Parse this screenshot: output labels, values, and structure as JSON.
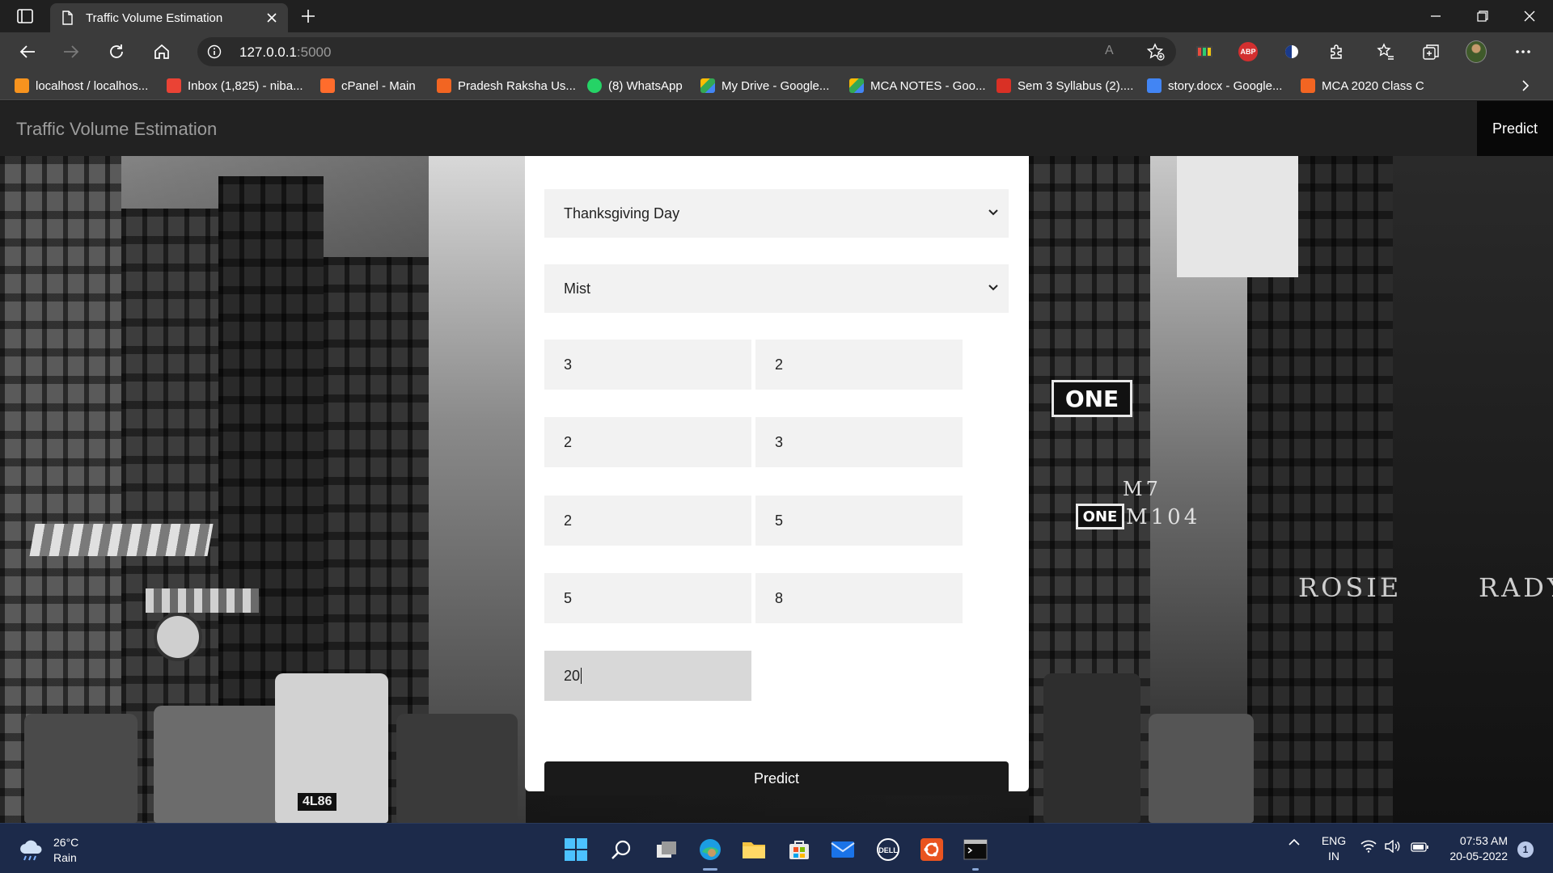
{
  "browser": {
    "tab_title": "Traffic Volume Estimation",
    "url_host": "127.0.0.1",
    "url_port": ":5000",
    "read_aloud_label": "A",
    "bookmarks": [
      {
        "label": "localhost / localhos...",
        "icon_color": "#f7931e"
      },
      {
        "label": "Inbox (1,825) - niba...",
        "icon_color": "#ea4335"
      },
      {
        "label": "cPanel - Main",
        "icon_color": "#ff6c2c"
      },
      {
        "label": "Pradesh Raksha Us...",
        "icon_color": "#f26522"
      },
      {
        "label": "(8) WhatsApp",
        "icon_color": "#25d366"
      },
      {
        "label": "My Drive - Google...",
        "icon_color": "#34a853"
      },
      {
        "label": "MCA NOTES - Goo...",
        "icon_color": "#4285f4"
      },
      {
        "label": "Sem 3 Syllabus (2)....",
        "icon_color": "#d93025"
      },
      {
        "label": "story.docx - Google...",
        "icon_color": "#4285f4"
      },
      {
        "label": "MCA 2020 Class C",
        "icon_color": "#f26522"
      }
    ],
    "extensions": {
      "abp_label": "ABP"
    }
  },
  "site": {
    "brand": "Traffic Volume Estimation",
    "nav_link": "Predict"
  },
  "form": {
    "holiday_select": "Thanksgiving Day",
    "weather_select": "Mist",
    "fields": [
      {
        "value": "3"
      },
      {
        "value": "2"
      },
      {
        "value": "2"
      },
      {
        "value": "3"
      },
      {
        "value": "2"
      },
      {
        "value": "5"
      },
      {
        "value": "5"
      },
      {
        "value": "8"
      },
      {
        "value": "20"
      }
    ],
    "submit_label": "Predict"
  },
  "street_scene": {
    "sign_one": "ONE",
    "sign_one_small": "ONE",
    "route_m104": "M104",
    "route_m7": "M7",
    "theatre_text": "ROSIE",
    "theatre_text_2": "RADY",
    "taxi_plate": "4L86"
  },
  "taskbar": {
    "weather_temp": "26°C",
    "weather_desc": "Rain",
    "lang_top": "ENG",
    "lang_bottom": "IN",
    "time": "07:53 AM",
    "date": "20-05-2022",
    "notifications": "1"
  },
  "colors": {
    "accent_dark": "#1a1a1a",
    "navbar": "#222222",
    "taskbar": "#1c2a4a"
  }
}
